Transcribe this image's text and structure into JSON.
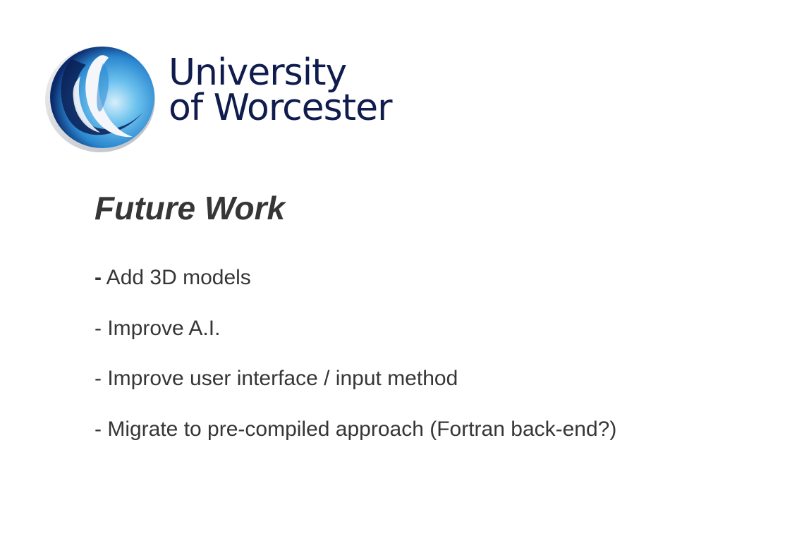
{
  "logo": {
    "line1": "University",
    "line2": "of Worcester",
    "emblem_icon": "university-of-worcester-emblem-icon",
    "colors": {
      "text": "#0f1c4d",
      "emblem_dark": "#0b2a6b",
      "emblem_light": "#4fb3e8"
    }
  },
  "slide": {
    "title": "Future Work",
    "bullets": [
      {
        "dash": "-",
        "text": " Add 3D models"
      },
      {
        "dash": "-",
        "text": " Improve A.I."
      },
      {
        "dash": "-",
        "text": " Improve user interface / input method"
      },
      {
        "dash": "-",
        "text": " Migrate to pre-compiled approach (Fortran back-end?)"
      }
    ]
  }
}
